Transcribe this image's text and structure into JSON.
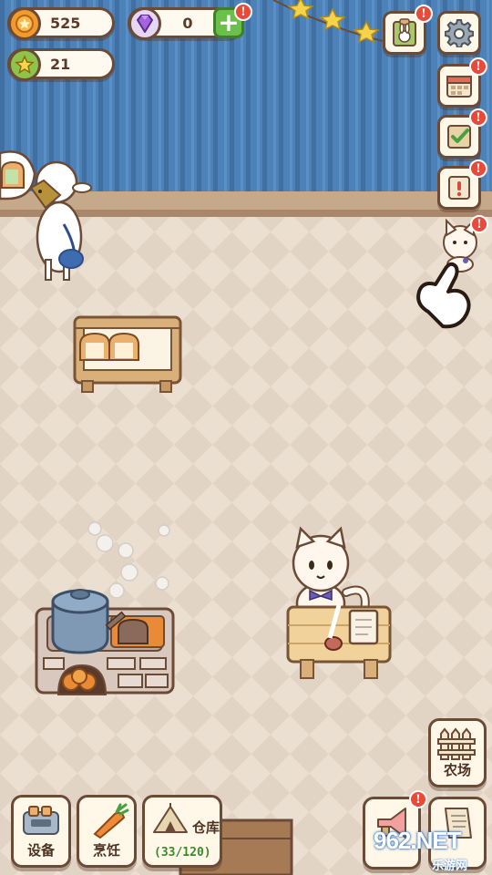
{
  "resources": {
    "coins": "525",
    "gems": "0",
    "level": "21"
  },
  "badges": {
    "alert": "!"
  },
  "bottom_bar": {
    "equipment_label": "设备",
    "cooking_label": "烹饪",
    "warehouse_label": "仓库",
    "warehouse_count": "(33/120)",
    "farm_label": "农场"
  },
  "watermark": {
    "main": "962.NET",
    "sub": "乐游网"
  },
  "colors": {
    "wall": "#4a7fb5",
    "floor": "#e9ddd0",
    "outline": "#6b4a36",
    "alert_badge": "#e84a3a",
    "add_button": "#6cc04a"
  },
  "icons": {
    "coin": "coin-icon",
    "gem": "gem-icon",
    "level_star": "star-icon",
    "settings": "gear-icon",
    "bunny_clipboard": "bunny-clipboard-icon",
    "calendar": "calendar-icon",
    "tasks": "checkmark-icon",
    "notice": "exclamation-icon",
    "farm": "fence-icon",
    "equipment": "toaster-icon",
    "cooking": "carrot-icon",
    "warehouse": "tent-icon",
    "megaphone": "megaphone-icon",
    "recipes": "scroll-icon"
  }
}
